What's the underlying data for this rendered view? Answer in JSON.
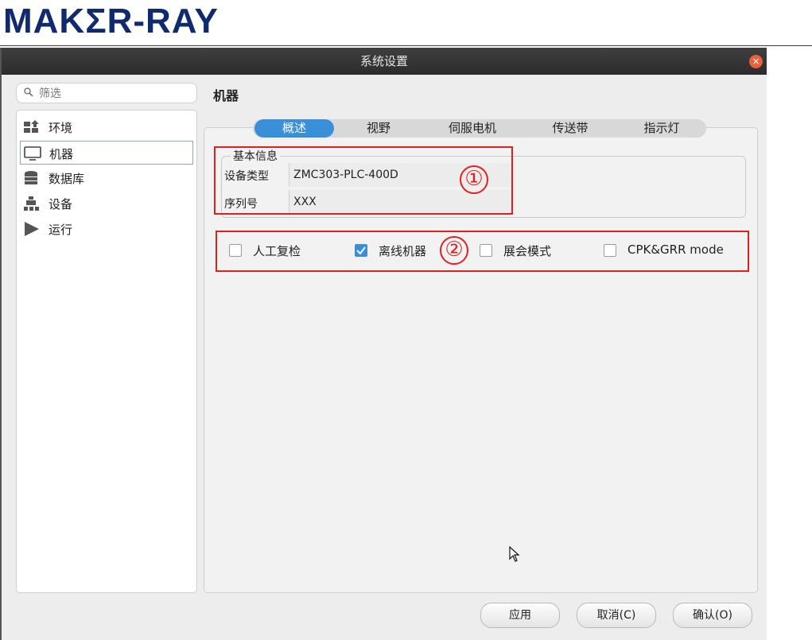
{
  "brand": {
    "logo_text": "MAKΣR-RAY",
    "color": "#0f2a6e"
  },
  "window": {
    "title": "系统设置",
    "close_icon": "close-icon"
  },
  "search": {
    "placeholder": "筛选"
  },
  "sidebar": {
    "items": [
      {
        "label": "环境",
        "icon": "environment-icon",
        "selected": false
      },
      {
        "label": "机器",
        "icon": "monitor-icon",
        "selected": true
      },
      {
        "label": "数据库",
        "icon": "database-icon",
        "selected": false
      },
      {
        "label": "设备",
        "icon": "device-icon",
        "selected": false
      },
      {
        "label": "运行",
        "icon": "run-icon",
        "selected": false
      }
    ]
  },
  "main": {
    "section_title": "机器",
    "tabs": [
      {
        "label": "概述",
        "active": true
      },
      {
        "label": "视野",
        "active": false
      },
      {
        "label": "伺服电机",
        "active": false
      },
      {
        "label": "传送带",
        "active": false
      },
      {
        "label": "指示灯",
        "active": false
      }
    ],
    "basic_info": {
      "legend": "基本信息",
      "device_type_label": "设备类型",
      "device_type_value": "ZMC303-PLC-400D",
      "serial_label": "序列号",
      "serial_value": "XXX"
    },
    "options": [
      {
        "label": "人工复检",
        "checked": false
      },
      {
        "label": "离线机器",
        "checked": true
      },
      {
        "label": "展会模式",
        "checked": false
      },
      {
        "label": "CPK&GRR mode",
        "checked": false
      }
    ]
  },
  "annotations": {
    "marker_1": "①",
    "marker_2": "②",
    "color": "#e02020"
  },
  "buttons": {
    "apply": "应用",
    "cancel": "取消(C)",
    "ok": "确认(O)"
  },
  "colors": {
    "accent": "#3a8fd9",
    "titlebar": "#2f2f2f"
  }
}
